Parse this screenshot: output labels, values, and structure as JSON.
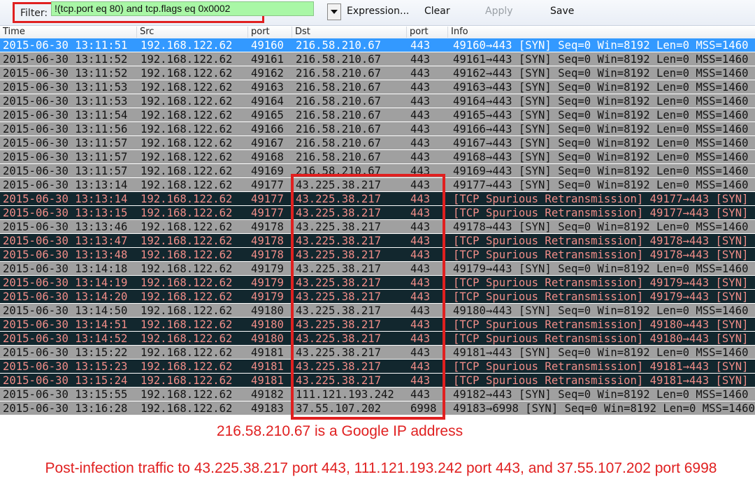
{
  "toolbar": {
    "filter_label": "Filter:",
    "filter_value": "!(tcp.port eq 80) and tcp.flags eq 0x0002",
    "expression_label": "Expression...",
    "clear_label": "Clear",
    "apply_label": "Apply",
    "save_label": "Save"
  },
  "columns": [
    "Time",
    "Src",
    "port",
    "Dst",
    "port",
    "Info"
  ],
  "packets": [
    {
      "time": "2015-06-30 13:11:51",
      "src": "192.168.122.62",
      "sport": "49160",
      "dst": "216.58.210.67",
      "dport": "443",
      "info": "49160→443 [SYN] Seq=0 Win=8192 Len=0 MSS=1460",
      "style": "selected"
    },
    {
      "time": "2015-06-30 13:11:52",
      "src": "192.168.122.62",
      "sport": "49161",
      "dst": "216.58.210.67",
      "dport": "443",
      "info": "49161→443 [SYN] Seq=0 Win=8192 Len=0 MSS=1460",
      "style": "normal"
    },
    {
      "time": "2015-06-30 13:11:52",
      "src": "192.168.122.62",
      "sport": "49162",
      "dst": "216.58.210.67",
      "dport": "443",
      "info": "49162→443 [SYN] Seq=0 Win=8192 Len=0 MSS=1460",
      "style": "normal"
    },
    {
      "time": "2015-06-30 13:11:53",
      "src": "192.168.122.62",
      "sport": "49163",
      "dst": "216.58.210.67",
      "dport": "443",
      "info": "49163→443 [SYN] Seq=0 Win=8192 Len=0 MSS=1460",
      "style": "normal"
    },
    {
      "time": "2015-06-30 13:11:53",
      "src": "192.168.122.62",
      "sport": "49164",
      "dst": "216.58.210.67",
      "dport": "443",
      "info": "49164→443 [SYN] Seq=0 Win=8192 Len=0 MSS=1460",
      "style": "normal"
    },
    {
      "time": "2015-06-30 13:11:54",
      "src": "192.168.122.62",
      "sport": "49165",
      "dst": "216.58.210.67",
      "dport": "443",
      "info": "49165→443 [SYN] Seq=0 Win=8192 Len=0 MSS=1460",
      "style": "normal"
    },
    {
      "time": "2015-06-30 13:11:56",
      "src": "192.168.122.62",
      "sport": "49166",
      "dst": "216.58.210.67",
      "dport": "443",
      "info": "49166→443 [SYN] Seq=0 Win=8192 Len=0 MSS=1460",
      "style": "normal"
    },
    {
      "time": "2015-06-30 13:11:57",
      "src": "192.168.122.62",
      "sport": "49167",
      "dst": "216.58.210.67",
      "dport": "443",
      "info": "49167→443 [SYN] Seq=0 Win=8192 Len=0 MSS=1460",
      "style": "normal"
    },
    {
      "time": "2015-06-30 13:11:57",
      "src": "192.168.122.62",
      "sport": "49168",
      "dst": "216.58.210.67",
      "dport": "443",
      "info": "49168→443 [SYN] Seq=0 Win=8192 Len=0 MSS=1460",
      "style": "normal"
    },
    {
      "time": "2015-06-30 13:11:57",
      "src": "192.168.122.62",
      "sport": "49169",
      "dst": "216.58.210.67",
      "dport": "443",
      "info": "49169→443 [SYN] Seq=0 Win=8192 Len=0 MSS=1460",
      "style": "normal"
    },
    {
      "time": "2015-06-30 13:13:14",
      "src": "192.168.122.62",
      "sport": "49177",
      "dst": "43.225.38.217",
      "dport": "443",
      "info": "49177→443 [SYN] Seq=0 Win=8192 Len=0 MSS=1460",
      "style": "normal"
    },
    {
      "time": "2015-06-30 13:13:14",
      "src": "192.168.122.62",
      "sport": "49177",
      "dst": "43.225.38.217",
      "dport": "443",
      "info": "[TCP Spurious Retransmission] 49177→443 [SYN]",
      "style": "retrans"
    },
    {
      "time": "2015-06-30 13:13:15",
      "src": "192.168.122.62",
      "sport": "49177",
      "dst": "43.225.38.217",
      "dport": "443",
      "info": "[TCP Spurious Retransmission] 49177→443 [SYN]",
      "style": "retrans"
    },
    {
      "time": "2015-06-30 13:13:46",
      "src": "192.168.122.62",
      "sport": "49178",
      "dst": "43.225.38.217",
      "dport": "443",
      "info": "49178→443 [SYN] Seq=0 Win=8192 Len=0 MSS=1460",
      "style": "normal"
    },
    {
      "time": "2015-06-30 13:13:47",
      "src": "192.168.122.62",
      "sport": "49178",
      "dst": "43.225.38.217",
      "dport": "443",
      "info": "[TCP Spurious Retransmission] 49178→443 [SYN]",
      "style": "retrans"
    },
    {
      "time": "2015-06-30 13:13:48",
      "src": "192.168.122.62",
      "sport": "49178",
      "dst": "43.225.38.217",
      "dport": "443",
      "info": "[TCP Spurious Retransmission] 49178→443 [SYN]",
      "style": "retrans"
    },
    {
      "time": "2015-06-30 13:14:18",
      "src": "192.168.122.62",
      "sport": "49179",
      "dst": "43.225.38.217",
      "dport": "443",
      "info": "49179→443 [SYN] Seq=0 Win=8192 Len=0 MSS=1460",
      "style": "normal"
    },
    {
      "time": "2015-06-30 13:14:19",
      "src": "192.168.122.62",
      "sport": "49179",
      "dst": "43.225.38.217",
      "dport": "443",
      "info": "[TCP Spurious Retransmission] 49179→443 [SYN]",
      "style": "retrans"
    },
    {
      "time": "2015-06-30 13:14:20",
      "src": "192.168.122.62",
      "sport": "49179",
      "dst": "43.225.38.217",
      "dport": "443",
      "info": "[TCP Spurious Retransmission] 49179→443 [SYN]",
      "style": "retrans"
    },
    {
      "time": "2015-06-30 13:14:50",
      "src": "192.168.122.62",
      "sport": "49180",
      "dst": "43.225.38.217",
      "dport": "443",
      "info": "49180→443 [SYN] Seq=0 Win=8192 Len=0 MSS=1460",
      "style": "normal"
    },
    {
      "time": "2015-06-30 13:14:51",
      "src": "192.168.122.62",
      "sport": "49180",
      "dst": "43.225.38.217",
      "dport": "443",
      "info": "[TCP Spurious Retransmission] 49180→443 [SYN]",
      "style": "retrans"
    },
    {
      "time": "2015-06-30 13:14:52",
      "src": "192.168.122.62",
      "sport": "49180",
      "dst": "43.225.38.217",
      "dport": "443",
      "info": "[TCP Spurious Retransmission] 49180→443 [SYN]",
      "style": "retrans"
    },
    {
      "time": "2015-06-30 13:15:22",
      "src": "192.168.122.62",
      "sport": "49181",
      "dst": "43.225.38.217",
      "dport": "443",
      "info": "49181→443 [SYN] Seq=0 Win=8192 Len=0 MSS=1460",
      "style": "normal"
    },
    {
      "time": "2015-06-30 13:15:23",
      "src": "192.168.122.62",
      "sport": "49181",
      "dst": "43.225.38.217",
      "dport": "443",
      "info": "[TCP Spurious Retransmission] 49181→443 [SYN]",
      "style": "retrans"
    },
    {
      "time": "2015-06-30 13:15:24",
      "src": "192.168.122.62",
      "sport": "49181",
      "dst": "43.225.38.217",
      "dport": "443",
      "info": "[TCP Spurious Retransmission] 49181→443 [SYN]",
      "style": "retrans"
    },
    {
      "time": "2015-06-30 13:15:55",
      "src": "192.168.122.62",
      "sport": "49182",
      "dst": "111.121.193.242",
      "dport": "443",
      "info": "49182→443 [SYN] Seq=0 Win=8192 Len=0 MSS=1460",
      "style": "normal"
    },
    {
      "time": "2015-06-30 13:16:28",
      "src": "192.168.122.62",
      "sport": "49183",
      "dst": "37.55.107.202",
      "dport": "6998",
      "info": "49183→6998 [SYN] Seq=0 Win=8192 Len=0 MSS=1460",
      "style": "normal"
    }
  ],
  "annotations": {
    "google_note": "216.58.210.67 is a Google IP address",
    "post_infection_note": "Post-infection traffic to 43.225.38.217 port 443, 111.121.193.242 port 443, and 37.55.107.202 port 6998"
  },
  "colors": {
    "annotation_red": "#e02020",
    "filter_valid_green": "#a9f7a6",
    "row_normal": "#a0a0a0",
    "row_selected": "#3399ff",
    "row_retrans_bg": "#12272e",
    "row_retrans_text": "#f08d88"
  }
}
